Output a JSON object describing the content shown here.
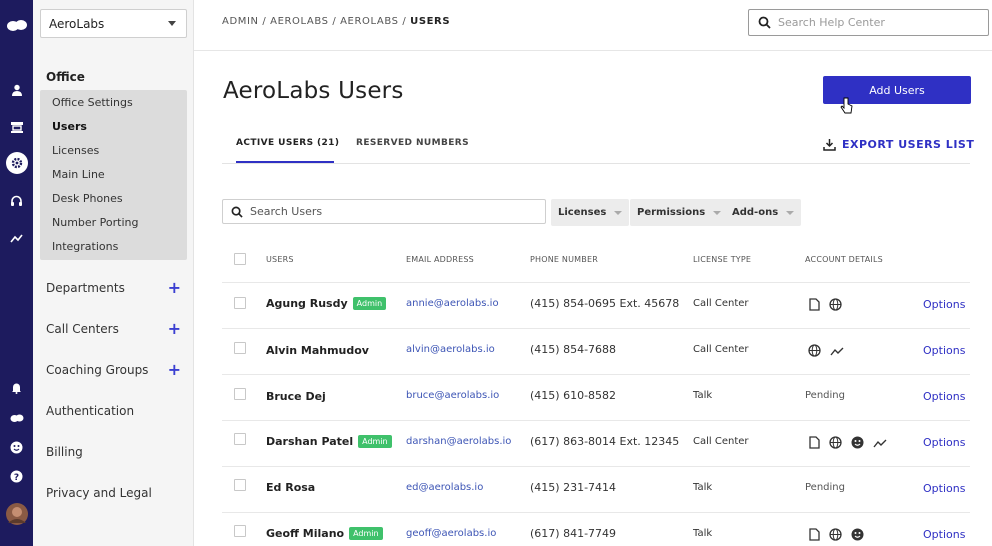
{
  "sidebar": {
    "org_select": "AeroLabs",
    "office_header": "Office",
    "office_items": [
      {
        "label": "Office Settings"
      },
      {
        "label": "Users"
      },
      {
        "label": "Licenses"
      },
      {
        "label": "Main Line"
      },
      {
        "label": "Desk Phones"
      },
      {
        "label": "Number Porting"
      },
      {
        "label": "Integrations"
      }
    ],
    "sections": [
      {
        "label": "Departments",
        "has_add": true
      },
      {
        "label": "Call Centers",
        "has_add": true
      },
      {
        "label": "Coaching Groups",
        "has_add": true
      },
      {
        "label": "Authentication",
        "has_add": false
      },
      {
        "label": "Billing",
        "has_add": false
      },
      {
        "label": "Privacy and Legal",
        "has_add": false
      }
    ],
    "add_symbol": "+"
  },
  "header": {
    "breadcrumb_prefix": "ADMIN / AEROLABS / AEROLABS / ",
    "breadcrumb_current": "USERS",
    "help_search_placeholder": "Search Help Center"
  },
  "main": {
    "title": "AeroLabs Users",
    "add_button": "Add Users",
    "tabs": [
      {
        "label": "ACTIVE USERS (21)"
      },
      {
        "label": "RESERVED NUMBERS"
      }
    ],
    "export_label": "EXPORT USERS LIST",
    "search_placeholder": "Search Users",
    "filters": [
      {
        "label": "Licenses"
      },
      {
        "label": "Permissions"
      },
      {
        "label": "Add-ons"
      }
    ],
    "columns": {
      "users": "USERS",
      "email": "EMAIL ADDRESS",
      "phone": "PHONE NUMBER",
      "license": "LICENSE TYPE",
      "account": "ACCOUNT DETAILS"
    },
    "rows": [
      {
        "name": "Agung Rusdy",
        "badge": "Admin",
        "email": "annie@aerolabs.io",
        "phone": "(415) 854-0695 Ext. 45678",
        "license": "Call Center",
        "details": [
          "document-icon",
          "globe-icon"
        ],
        "options": "Options"
      },
      {
        "name": "Alvin Mahmudov",
        "badge": "",
        "email": "alvin@aerolabs.io",
        "phone": "(415) 854-7688",
        "license": "Call Center",
        "details": [
          "globe-icon",
          "trend-icon"
        ],
        "options": "Options"
      },
      {
        "name": "Bruce Dej",
        "badge": "",
        "email": "bruce@aerolabs.io",
        "phone": "(415) 610-8582",
        "license": "Talk",
        "status": "Pending",
        "details": [],
        "options": "Options"
      },
      {
        "name": "Darshan Patel",
        "badge": "Admin",
        "email": "darshan@aerolabs.io",
        "phone": "(617) 863-8014 Ext. 12345",
        "license": "Call Center",
        "details": [
          "document-icon",
          "globe-icon",
          "face-icon",
          "trend-icon"
        ],
        "options": "Options"
      },
      {
        "name": "Ed Rosa",
        "badge": "",
        "email": "ed@aerolabs.io",
        "phone": "(415) 231-7414",
        "license": "Talk",
        "status": "Pending",
        "details": [],
        "options": "Options"
      },
      {
        "name": "Geoff Milano",
        "badge": "Admin",
        "email": "geoff@aerolabs.io",
        "phone": "(617) 841-7749",
        "license": "Talk",
        "details": [
          "document-icon",
          "globe-icon",
          "face-icon"
        ],
        "options": "Options"
      }
    ]
  },
  "colors": {
    "rail": "#1d1b5e",
    "accent": "#2f30c4",
    "admin_badge": "#3fc16b",
    "link": "#3d55b5"
  }
}
